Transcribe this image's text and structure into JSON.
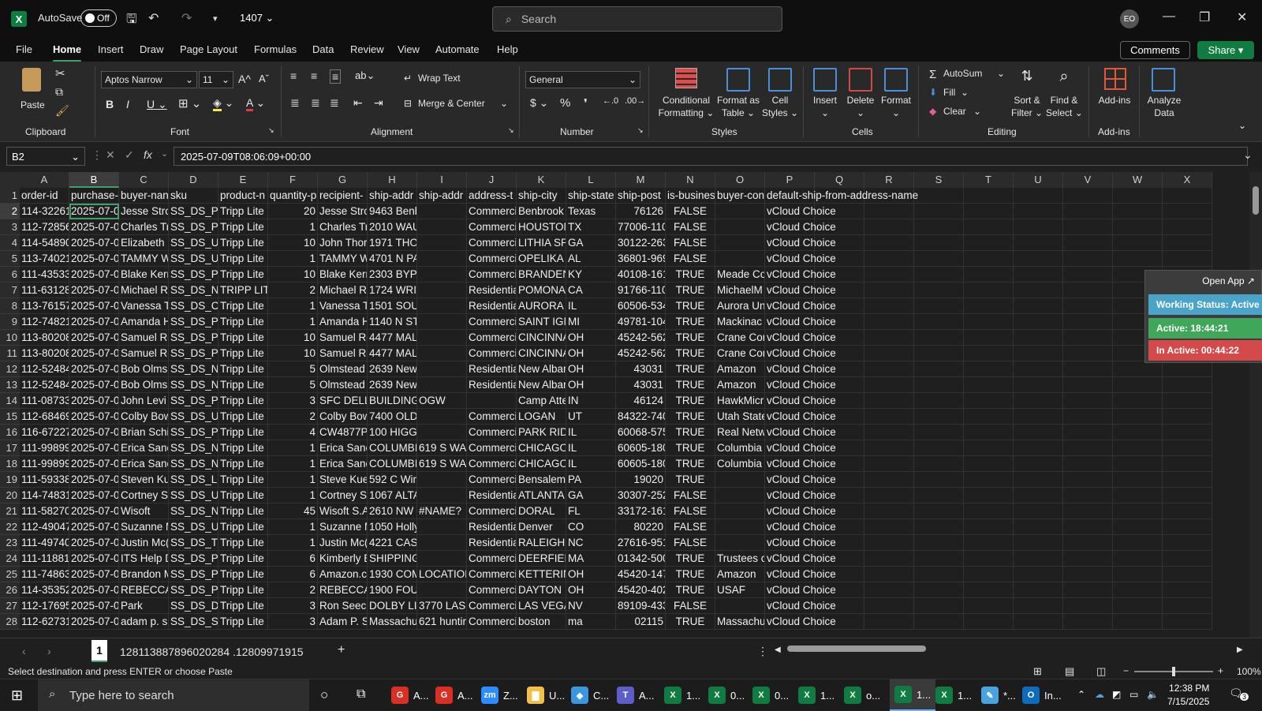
{
  "titlebar": {
    "autosave_label": "AutoSave",
    "toggle_state": "Off",
    "doc_name": "1407",
    "search_placeholder": "Search",
    "avatar_initials": "EO"
  },
  "menu": [
    "File",
    "Home",
    "Insert",
    "Draw",
    "Page Layout",
    "Formulas",
    "Data",
    "Review",
    "View",
    "Automate",
    "Help"
  ],
  "menu_active": "Home",
  "top_buttons": {
    "comments": "Comments",
    "share": "Share"
  },
  "ribbon": {
    "paste": "Paste",
    "font_name": "Aptos Narrow",
    "font_size": "11",
    "wrap_text": "Wrap Text",
    "merge_center": "Merge & Center",
    "number_format": "General",
    "conditional_formatting": [
      "Conditional",
      "Formatting"
    ],
    "format_as_table": [
      "Format as",
      "Table"
    ],
    "cell_styles": [
      "Cell",
      "Styles"
    ],
    "insert": "Insert",
    "delete": "Delete",
    "format": "Format",
    "autosum": "AutoSum",
    "fill": "Fill",
    "clear": "Clear",
    "sort_filter": [
      "Sort &",
      "Filter"
    ],
    "find_select": [
      "Find &",
      "Select"
    ],
    "addins": "Add-ins",
    "analyze_data": [
      "Analyze",
      "Data"
    ],
    "groups": {
      "clipboard": "Clipboard",
      "font": "Font",
      "alignment": "Alignment",
      "number": "Number",
      "styles": "Styles",
      "cells": "Cells",
      "editing": "Editing",
      "addins": "Add-ins"
    }
  },
  "formula_bar": {
    "name_box": "B2",
    "formula": "2025-07-09T08:06:09+00:00"
  },
  "columns": [
    "A",
    "B",
    "C",
    "D",
    "E",
    "F",
    "G",
    "H",
    "I",
    "J",
    "K",
    "L",
    "M",
    "N",
    "O",
    "P",
    "Q",
    "R",
    "S",
    "T",
    "U",
    "V",
    "W",
    "X"
  ],
  "row_numbers": [
    "1",
    "2",
    "3",
    "4",
    "5",
    "6",
    "7",
    "8",
    "9",
    "10",
    "11",
    "12",
    "13",
    "14",
    "15",
    "16",
    "17",
    "18",
    "19",
    "20",
    "21",
    "22",
    "23",
    "24",
    "25",
    "26",
    "27",
    "28"
  ],
  "headers": [
    "order-id",
    "purchase-",
    "buyer-nan",
    "sku",
    "product-n",
    "quantity-p",
    "recipient-",
    "ship-addr",
    "ship-addr",
    "address-t",
    "ship-city",
    "ship-state",
    "ship-post",
    "is-busines",
    "buyer-con",
    "default-ship-from-address-name"
  ],
  "rows": [
    [
      "114-32261",
      "2025-07-0!",
      "Jesse Stro",
      "SS_DS_P0(",
      "Tripp Lite S",
      "20",
      "Jesse Stro",
      "9463 Benbrook Blvd.",
      "",
      "Commerci",
      "Benbrook",
      "Texas",
      "76126",
      "FALSE",
      "",
      "vCloud Choice"
    ],
    [
      "112-72856",
      "2025-07-0!",
      "Charles Tr",
      "SS_DS_P0(",
      "Tripp Lite I",
      "1",
      "Charles Tr",
      "2010 WAUGH DR",
      "",
      "Commerci",
      "HOUSTON",
      "TX",
      "77006-110",
      "FALSE",
      "",
      "vCloud Choice"
    ],
    [
      "114-54890",
      "2025-07-0!",
      "Elizabeth",
      "SS_DS_U04",
      "Tripp Lite I",
      "10",
      "John Thor",
      "1971 THORNTON RD",
      "",
      "Commerci",
      "LITHIA SPF",
      "GA",
      "30122-263",
      "FALSE",
      "",
      "vCloud Choice"
    ],
    [
      "113-74021",
      "2025-07-0!",
      "TAMMY WI",
      "SS_DS_U02",
      "Tripp Lite I",
      "1",
      "TAMMY Wi",
      "4701 N PARK DR",
      "",
      "Commerci",
      "OPELIKA",
      "AL",
      "36801-969",
      "FALSE",
      "",
      "vCloud Choice"
    ],
    [
      "111-43533",
      "2025-07-0!",
      "Blake Kerr",
      "SS_DS_P77",
      "Tripp Lite I",
      "10",
      "Blake Kerr",
      "2303 BYPASS RD",
      "",
      "Commerci",
      "BRANDEN",
      "KY",
      "40108-161",
      "TRUE",
      "Meade Co",
      "vCloud Choice"
    ],
    [
      "111-63128",
      "2025-07-0!",
      "Michael R",
      "SS_DS_N3(",
      "TRIPP LITE",
      "2",
      "Michael R",
      "1724 WRIGHT ST",
      "",
      "Residentia",
      "POMONA",
      "CA",
      "91766-110",
      "TRUE",
      "MichaelM",
      "vCloud Choice"
    ],
    [
      "113-76157",
      "2025-07-0!",
      "Vanessa T",
      "SS_DS_CLA",
      "Tripp Lite I",
      "1",
      "Vanessa T",
      "1501 SOUTHLAWN PL",
      "",
      "Residentia",
      "AURORA",
      "IL",
      "60506-534",
      "TRUE",
      "Aurora Un",
      "vCloud Choice"
    ],
    [
      "112-74821",
      "2025-07-0!",
      "Amanda H",
      "SS_DS_PS-",
      "Tripp Lite I",
      "1",
      "Amanda H",
      "1140 N STATE ST",
      "",
      "Commerci",
      "SAINT IGN",
      "MI",
      "49781-104",
      "TRUE",
      "Mackinac",
      "vCloud Choice"
    ],
    [
      "113-80208",
      "2025-07-0!",
      "Samuel Ro",
      "SS_DS_P0(",
      "Tripp Lite S",
      "10",
      "Samuel Ro",
      "4477 MALSBARY RD",
      "",
      "Commerci",
      "CINCINNA",
      "OH",
      "45242-562",
      "TRUE",
      "Crane Con",
      "vCloud Choice"
    ],
    [
      "113-80208",
      "2025-07-0!",
      "Samuel Ro",
      "SS_DS_P0(",
      "Tripp Lite S",
      "10",
      "Samuel Ro",
      "4477 MALSBARY RD",
      "",
      "Commerci",
      "CINCINNA",
      "OH",
      "45242-562",
      "TRUE",
      "Crane Con",
      "vCloud Choice"
    ],
    [
      "112-52484",
      "2025-07-0!",
      "Bob Olms",
      "SS_DS_N2(",
      "Tripp Lite (",
      "5",
      "Olmstead",
      "2639 Newton Court",
      "",
      "Residentia",
      "New Albar",
      "OH",
      "43031",
      "TRUE",
      "Amazon",
      "vCloud Choice"
    ],
    [
      "112-52484",
      "2025-07-0!",
      "Bob Olms",
      "SS_DS_N2(",
      "Tripp Lite (",
      "5",
      "Olmstead",
      "2639 Newton Court",
      "",
      "Residentia",
      "New Albar",
      "OH",
      "43031",
      "TRUE",
      "Amazon",
      "vCloud Choice"
    ],
    [
      "111-08733",
      "2025-07-0!",
      "John Levi",
      "SS_DS_PS2",
      "Tripp Lite 4",
      "3",
      "SFC DELLII",
      "BUILDING",
      "OGW",
      "",
      "Camp Atte",
      "IN",
      "46124",
      "TRUE",
      "HawkMicr",
      "vCloud Choice"
    ],
    [
      "112-68469",
      "2025-07-0!",
      "Colby Bow",
      "SS_DS_U02",
      "Tripp Lite I",
      "2",
      "Colby Bow",
      "7400 OLD MAIN HL",
      "",
      "Commerci",
      "LOGAN",
      "UT",
      "84322-740",
      "TRUE",
      "Utah State",
      "vCloud Choice"
    ],
    [
      "116-67227",
      "2025-07-0!",
      "Brian Schi",
      "SS_DS_P0(",
      "Tripp Lite S",
      "4",
      "CW4877PC",
      "100 HIGGINS RD STE",
      "",
      "Commerci",
      "PARK RIDC",
      "IL",
      "60068-575",
      "TRUE",
      "Real Netw",
      "vCloud Choice"
    ],
    [
      "111-99899",
      "2025-07-0!",
      "Erica Sanc",
      "SS_DS_N2(",
      "Tripp Lite I",
      "1",
      "Erica Sanc",
      "COLUMBIA",
      "619 S WAB",
      "Commerci",
      "CHICAGO",
      "IL",
      "60605-180",
      "TRUE",
      "Columbia",
      "vCloud Choice"
    ],
    [
      "111-99899",
      "2025-07-0!",
      "Erica Sanc",
      "SS_DS_N0(",
      "Tripp Lite S",
      "1",
      "Erica Sanc",
      "COLUMBIA",
      "619 S WAB",
      "Commerci",
      "CHICAGO",
      "IL",
      "60605-180",
      "TRUE",
      "Columbia",
      "vCloud Choice"
    ],
    [
      "111-59338",
      "2025-07-0!",
      "Steven Ku",
      "SS_DS_LC1",
      "Tripp Lite I",
      "1",
      "Steve Kuel",
      "592 C Winks Lane",
      "",
      "Commerci",
      "Bensalem",
      "PA",
      "19020",
      "TRUE",
      "",
      "vCloud Choice"
    ],
    [
      "114-74831",
      "2025-07-0!",
      "Cortney Sr",
      "SS_DS_U32",
      "Tripp Lite I",
      "1",
      "Cortney Sr",
      "1067 ALTA AVE NE AP",
      "",
      "Residentia",
      "ATLANTA",
      "GA",
      "30307-252",
      "FALSE",
      "",
      "vCloud Choice"
    ],
    [
      "111-58270",
      "2025-07-0!",
      "Wisoft",
      "SS_DS_N0(",
      "Tripp Lite 8",
      "45",
      "Wisoft S.A",
      "2610 NW 8",
      "#NAME?",
      "Commerci",
      "DORAL",
      "FL",
      "33172-161",
      "FALSE",
      "",
      "vCloud Choice"
    ],
    [
      "112-49047",
      "2025-07-0!",
      "Suzanne M",
      "SS_DS_U44",
      "Tripp Lite I",
      "1",
      "Suzanne M",
      "1050 Holly Street",
      "",
      "Residentia",
      "Denver",
      "CO",
      "80220",
      "FALSE",
      "",
      "vCloud Choice"
    ],
    [
      "111-49740",
      "2025-07-0!",
      "Justin Mc(",
      "SS_DS_TLF",
      "Tripp Lite S",
      "1",
      "Justin Mc(",
      "4221 CASHEW DR",
      "",
      "Residentia",
      "RALEIGH",
      "NC",
      "27616-951",
      "FALSE",
      "",
      "vCloud Choice"
    ],
    [
      "111-11881",
      "2025-07-0!",
      "ITS Help D",
      "SS_DS_PD(",
      "Tripp Lite I",
      "6",
      "Kimberly E",
      "SHIPPING & RECEIVIN",
      "",
      "Commerci",
      "DEERFIELD",
      "MA",
      "01342-500",
      "TRUE",
      "Trustees c",
      "vCloud Choice"
    ],
    [
      "111-74863",
      "2025-07-0!",
      "Brandon M",
      "SS_DS_P0(",
      "Tripp Lite 2",
      "6",
      "Amazon.c",
      "1930 COM",
      "LOCATION",
      "Commerci",
      "KETTERIN(",
      "OH",
      "45420-147",
      "TRUE",
      "Amazon",
      "vCloud Choice"
    ],
    [
      "114-35352",
      "2025-07-0!",
      "REBECCA T",
      "SS_DS_P5(",
      "Tripp Lite I",
      "2",
      "REBECCA T",
      "1900 FOUNDERS DR",
      "",
      "Commerci",
      "DAYTON",
      "OH",
      "45420-402",
      "TRUE",
      "USAF",
      "vCloud Choice"
    ],
    [
      "112-17695",
      "2025-07-0!",
      "Park",
      "SS_DS_DW",
      "Tripp Lite I",
      "3",
      "Ron Seech",
      "DOLBY LIV",
      "3770 LAS V",
      "Commerci",
      "LAS VEGAS",
      "NV",
      "89109-433",
      "FALSE",
      "",
      "vCloud Choice"
    ],
    [
      "112-62731",
      "2025-07-0!",
      "adam p. s",
      "SS_DS_SS7",
      "Tripp Lite 1",
      "3",
      "Adam P. S",
      "Massachu",
      "621 huntir",
      "Commerci",
      "boston",
      "ma",
      "02115",
      "TRUE",
      "Massachu",
      "vCloud Choice"
    ]
  ],
  "popup": {
    "open_app": "Open App ↗",
    "working_status": "Working Status: Active",
    "active": "Active: 18:44:21",
    "inactive": "In Active: 00:44:22"
  },
  "sheet": {
    "tab": "1",
    "name": "128113887896020284 .12809971915"
  },
  "status": {
    "message": "Select destination and press ENTER or choose Paste",
    "zoom": "100%"
  },
  "taskbar": {
    "search_placeholder": "Type here to search",
    "apps": [
      {
        "label": "A...",
        "color": "#d93025",
        "glyph": "G"
      },
      {
        "label": "A...",
        "color": "#d93025",
        "glyph": "G"
      },
      {
        "label": "Z...",
        "color": "#2d8cff",
        "glyph": "zm"
      },
      {
        "label": "U...",
        "color": "#f0c04a",
        "glyph": "▇"
      },
      {
        "label": "C...",
        "color": "#3a96dd",
        "glyph": "◆"
      },
      {
        "label": "A...",
        "color": "#5b5fc7",
        "glyph": "T"
      },
      {
        "label": "1...",
        "color": "#107c41",
        "glyph": "X"
      },
      {
        "label": "0...",
        "color": "#107c41",
        "glyph": "X"
      },
      {
        "label": "0...",
        "color": "#107c41",
        "glyph": "X"
      },
      {
        "label": "1...",
        "color": "#107c41",
        "glyph": "X"
      },
      {
        "label": "o...",
        "color": "#107c41",
        "glyph": "X"
      },
      {
        "label": "1...",
        "color": "#107c41",
        "glyph": "X"
      },
      {
        "label": "1...",
        "color": "#107c41",
        "glyph": "X"
      },
      {
        "label": "*...",
        "color": "#4aa3df",
        "glyph": "✎"
      },
      {
        "label": "In...",
        "color": "#0f6cbd",
        "glyph": "O"
      }
    ],
    "time": "12:38 PM",
    "date": "7/15/2025",
    "notifications": "3"
  }
}
